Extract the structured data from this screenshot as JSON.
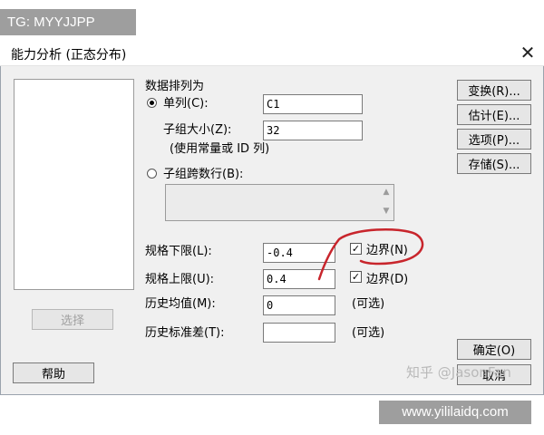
{
  "tag": {
    "text": "TG: MYYJJPP"
  },
  "window": {
    "title": "能力分析 (正态分布)",
    "close_symbol": "✕"
  },
  "left_panel": {
    "select_button": "选择",
    "help_button": "帮助"
  },
  "data_arrangement": {
    "header": "数据排列为",
    "single_column": {
      "label": "单列(C):",
      "value": "C1",
      "selected": true
    },
    "subgroup_size": {
      "label": "子组大小(Z):",
      "value": "32",
      "note": "(使用常量或 ID 列)"
    },
    "subgroups_across_rows": {
      "label": "子组跨数行(B):",
      "selected": false
    }
  },
  "spec_limits": {
    "lower": {
      "label": "规格下限(L):",
      "value": "-0.4",
      "boundary_label": "边界(N)",
      "boundary_checked": true
    },
    "upper": {
      "label": "规格上限(U):",
      "value": "0.4",
      "boundary_label": "边界(D)",
      "boundary_checked": true
    }
  },
  "history": {
    "mean": {
      "label": "历史均值(M):",
      "value": "0",
      "optional": "(可选)"
    },
    "stdev": {
      "label": "历史标准差(T):",
      "value": "",
      "optional": "(可选)"
    }
  },
  "right_buttons": [
    "变换(R)...",
    "估计(E)...",
    "选项(P)...",
    "存储(S)..."
  ],
  "footer_buttons": {
    "ok": "确定(O)",
    "cancel": "取消"
  },
  "annotation": {
    "color": "#c8252c"
  },
  "watermark": {
    "text": "知乎 @JasonFan"
  },
  "site_banner": {
    "text": "www.yililaidq.com"
  }
}
